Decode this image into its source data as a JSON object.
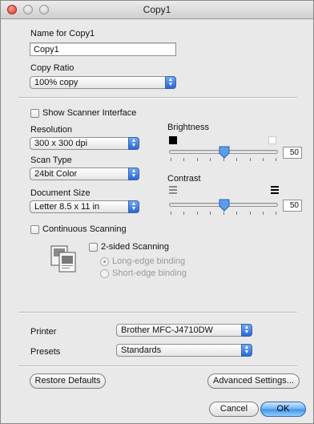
{
  "window": {
    "title": "Copy1"
  },
  "name_section": {
    "name_label": "Name for Copy1",
    "name_value": "Copy1",
    "ratio_label": "Copy Ratio",
    "ratio_value": "100% copy"
  },
  "scan": {
    "show_scanner_interface": {
      "label": "Show Scanner Interface",
      "checked": false
    },
    "resolution": {
      "label": "Resolution",
      "value": "300 x 300 dpi"
    },
    "scan_type": {
      "label": "Scan Type",
      "value": "24bit Color"
    },
    "document_size": {
      "label": "Document Size",
      "value": "Letter 8.5 x 11 in"
    },
    "brightness": {
      "label": "Brightness",
      "value": "50"
    },
    "contrast": {
      "label": "Contrast",
      "value": "50"
    },
    "continuous_scanning": {
      "label": "Continuous Scanning",
      "checked": false
    },
    "two_sided": {
      "label": "2-sided Scanning",
      "checked": false,
      "long_edge": "Long-edge binding",
      "short_edge": "Short-edge binding"
    }
  },
  "footer": {
    "printer_label": "Printer",
    "printer_value": "Brother MFC-J4710DW",
    "presets_label": "Presets",
    "presets_value": "Standards",
    "restore_defaults": "Restore Defaults",
    "advanced_settings": "Advanced Settings...",
    "cancel": "Cancel",
    "ok": "OK"
  },
  "colors": {
    "accent_blue": "#3e8fe8",
    "close_red": "#d8392d"
  }
}
